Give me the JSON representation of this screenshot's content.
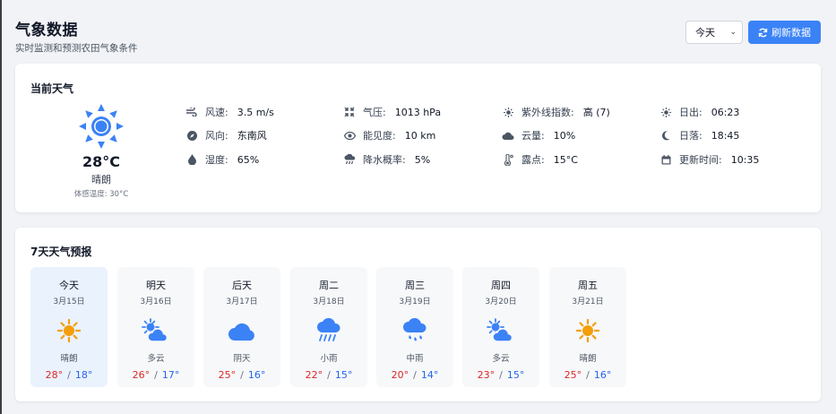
{
  "header": {
    "title": "气象数据",
    "subtitle": "实时监测和预测农田气象条件"
  },
  "controls": {
    "day_select": "今天",
    "refresh_label": "刷新数据"
  },
  "current": {
    "section_title": "当前天气",
    "icon": "sun-icon",
    "temperature": "28°C",
    "condition": "晴朗",
    "feels_like": "体感温度: 30°C",
    "metrics": {
      "wind_speed": {
        "label": "风速:",
        "value": "3.5 m/s",
        "icon": "wind-icon"
      },
      "wind_dir": {
        "label": "风向:",
        "value": "东南风",
        "icon": "compass-icon"
      },
      "humidity": {
        "label": "湿度:",
        "value": "65%",
        "icon": "droplet-icon"
      },
      "pressure": {
        "label": "气压:",
        "value": "1013 hPa",
        "icon": "compress-icon"
      },
      "visibility": {
        "label": "能见度:",
        "value": "10 km",
        "icon": "eye-icon"
      },
      "precip": {
        "label": "降水概率:",
        "value": "5%",
        "icon": "cloud-rain-icon"
      },
      "uv": {
        "label": "紫外线指数:",
        "value": "高 (7)",
        "icon": "sun-small-icon"
      },
      "cloud": {
        "label": "云量:",
        "value": "10%",
        "icon": "cloud-icon"
      },
      "dew": {
        "label": "露点:",
        "value": "15°C",
        "icon": "thermometer-icon"
      },
      "sunrise": {
        "label": "日出:",
        "value": "06:23",
        "icon": "sunrise-icon"
      },
      "sunset": {
        "label": "日落:",
        "value": "18:45",
        "icon": "moon-icon"
      },
      "updated": {
        "label": "更新时间:",
        "value": "10:35",
        "icon": "calendar-icon"
      }
    }
  },
  "forecast": {
    "section_title": "7天天气预报",
    "days": [
      {
        "name": "今天",
        "date": "3月15日",
        "icon": "sun-icon",
        "condition": "晴朗",
        "high": "28°",
        "low": "18°"
      },
      {
        "name": "明天",
        "date": "3月16日",
        "icon": "partly-cloudy-icon",
        "condition": "多云",
        "high": "26°",
        "low": "17°"
      },
      {
        "name": "后天",
        "date": "3月17日",
        "icon": "cloud-icon",
        "condition": "阴天",
        "high": "25°",
        "low": "16°"
      },
      {
        "name": "周二",
        "date": "3月18日",
        "icon": "cloud-showers-icon",
        "condition": "小雨",
        "high": "22°",
        "low": "15°"
      },
      {
        "name": "周三",
        "date": "3月19日",
        "icon": "cloud-rain-icon",
        "condition": "中雨",
        "high": "20°",
        "low": "14°"
      },
      {
        "name": "周四",
        "date": "3月20日",
        "icon": "partly-cloudy-icon",
        "condition": "多云",
        "high": "23°",
        "low": "15°"
      },
      {
        "name": "周五",
        "date": "3月21日",
        "icon": "sun-icon",
        "condition": "晴朗",
        "high": "25°",
        "low": "16°"
      }
    ],
    "range_sep": "/"
  },
  "colors": {
    "accent": "#3b82f6",
    "sun": "#f59e0b",
    "high": "#dc2626",
    "low": "#2563eb"
  }
}
